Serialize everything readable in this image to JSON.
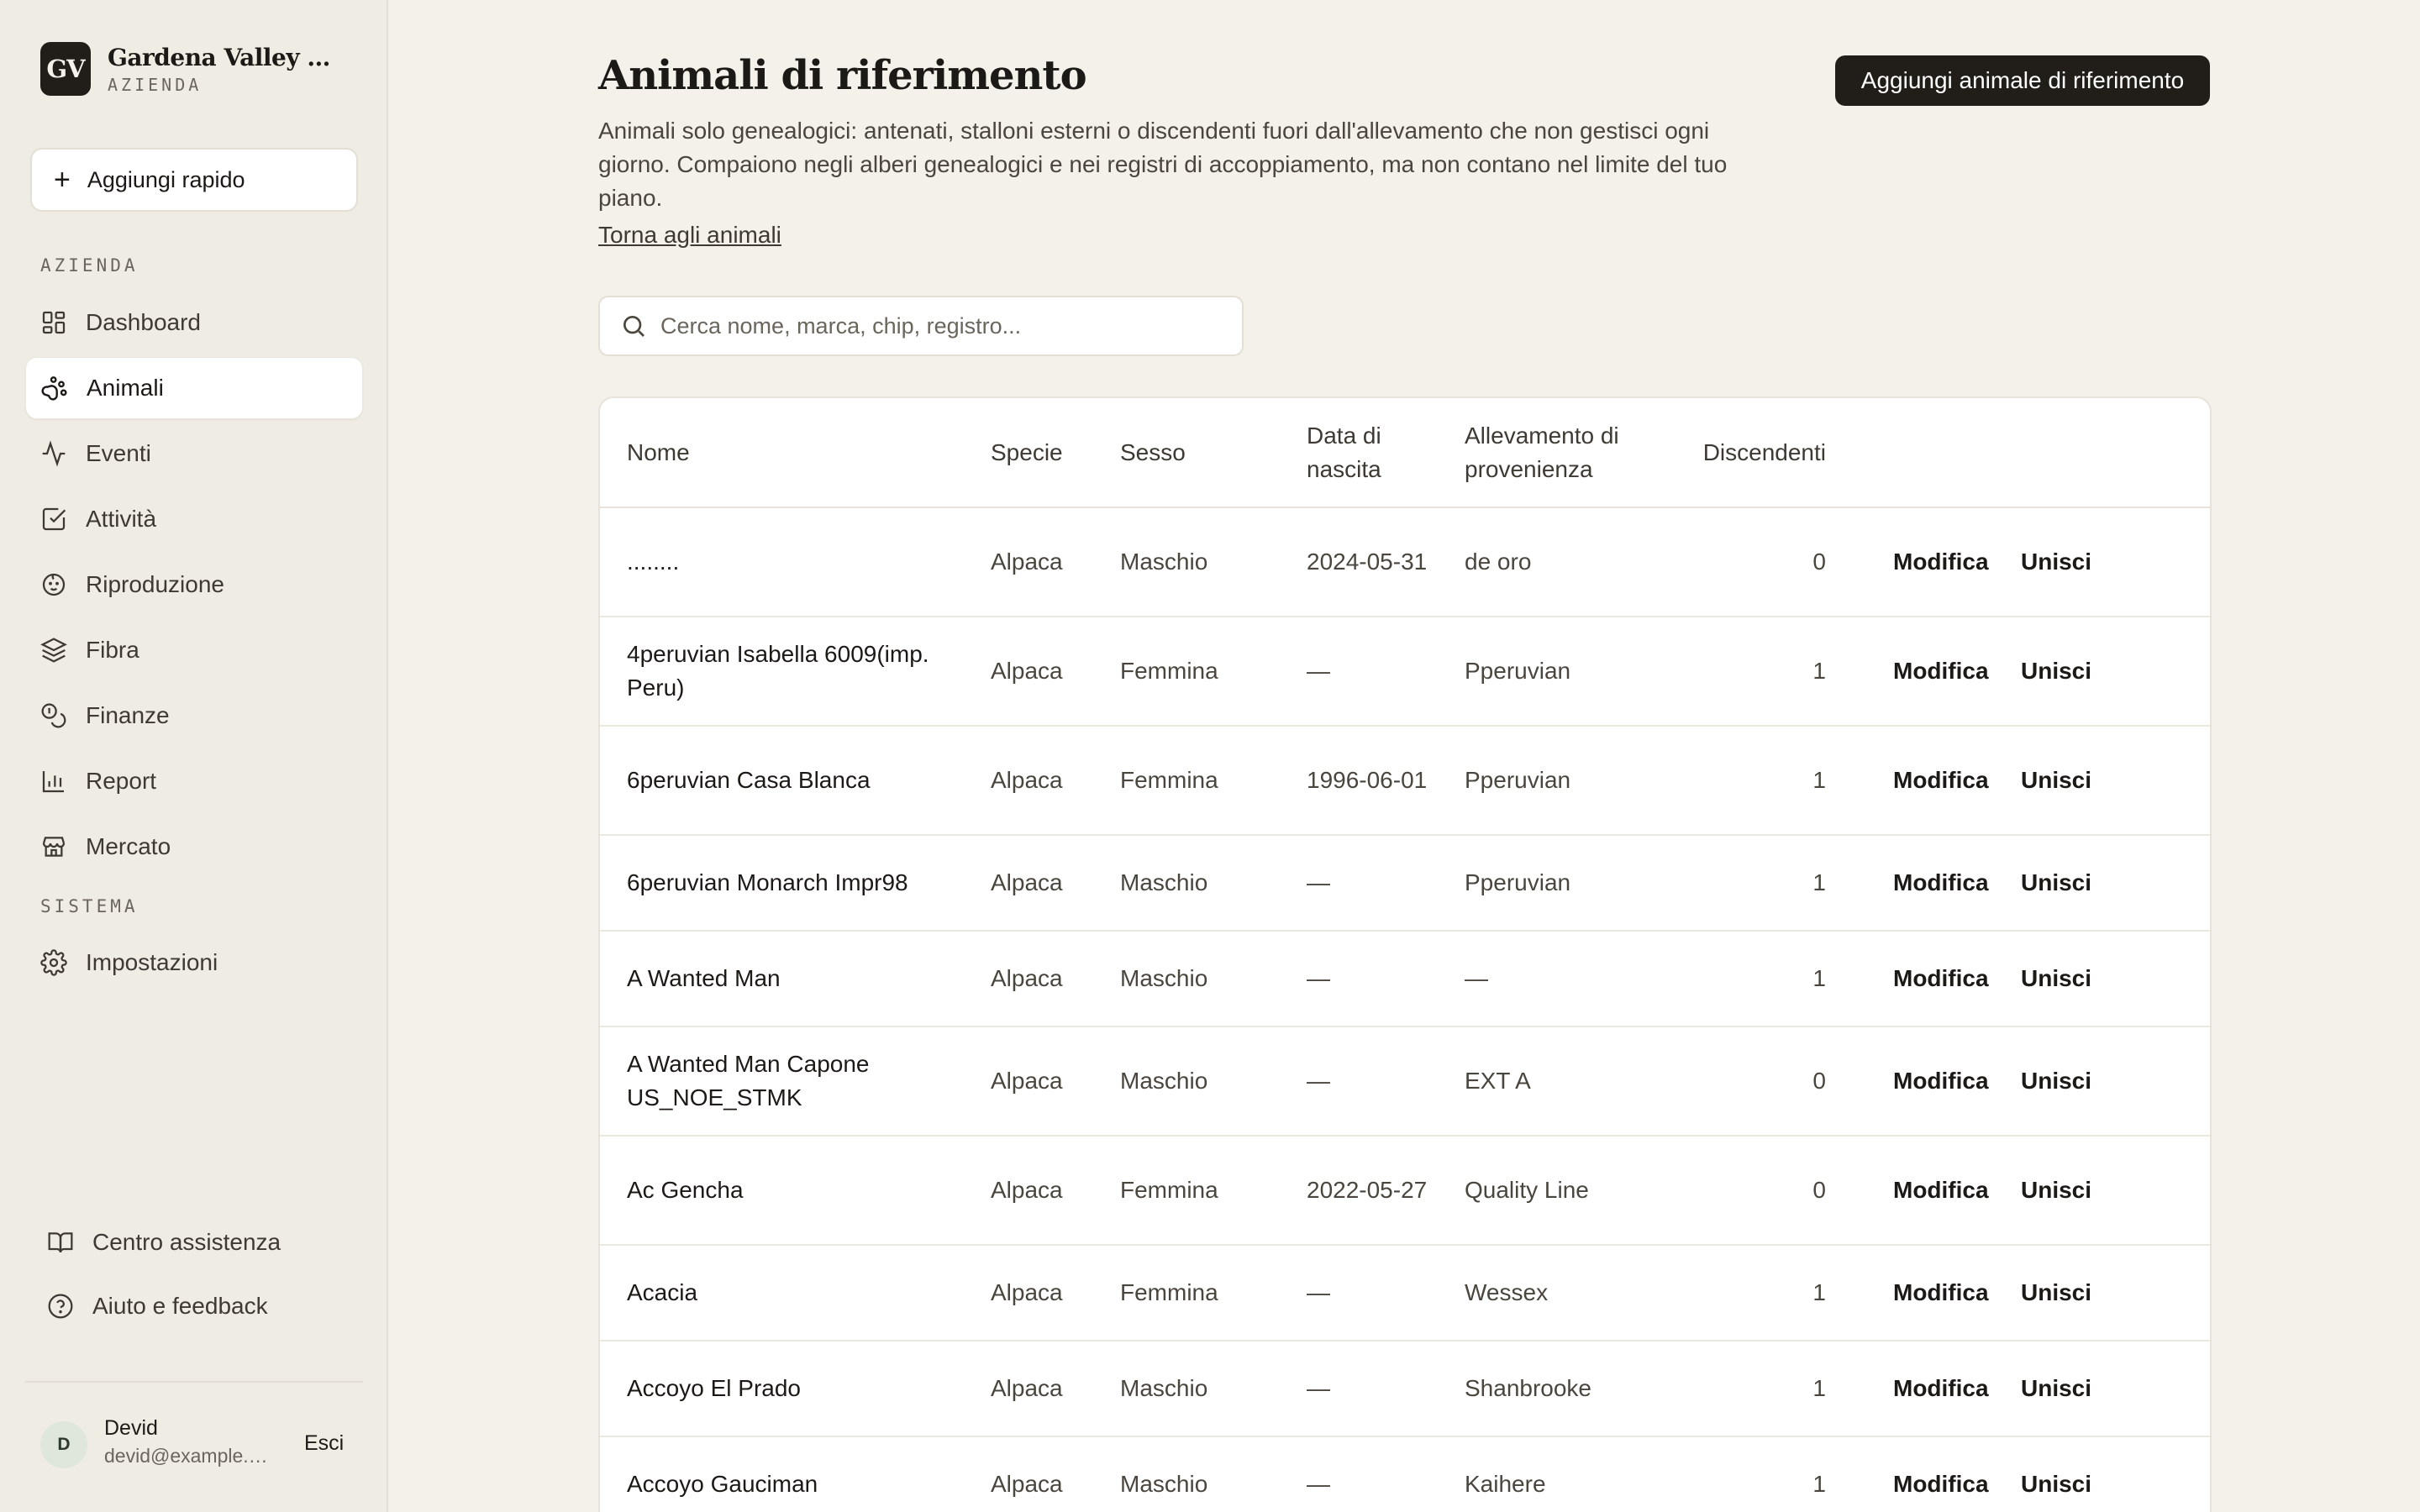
{
  "brand": {
    "logo_text": "GV",
    "name": "Gardena Valley Alpacas",
    "subtitle": "AZIENDA"
  },
  "quick_add": {
    "label": "Aggiungi rapido"
  },
  "sidebar": {
    "section_farm": "AZIENDA",
    "section_system": "SISTEMA",
    "items": [
      {
        "label": "Dashboard",
        "icon": "dashboard-icon"
      },
      {
        "label": "Animali",
        "icon": "paw-icon",
        "active": true
      },
      {
        "label": "Eventi",
        "icon": "activity-icon"
      },
      {
        "label": "Attività",
        "icon": "checkbox-icon"
      },
      {
        "label": "Riproduzione",
        "icon": "baby-icon"
      },
      {
        "label": "Fibra",
        "icon": "layers-icon"
      },
      {
        "label": "Finanze",
        "icon": "coins-icon"
      },
      {
        "label": "Report",
        "icon": "bar-chart-icon"
      },
      {
        "label": "Mercato",
        "icon": "store-icon"
      }
    ],
    "settings": {
      "label": "Impostazioni",
      "icon": "gear-icon"
    },
    "help_center": "Centro assistenza",
    "help_feedback": "Aiuto e feedback"
  },
  "user": {
    "initial": "D",
    "name": "Devid",
    "email": "devid@example.com",
    "logout": "Esci"
  },
  "page": {
    "title": "Animali di riferimento",
    "add_button": "Aggiungi animale di riferimento",
    "description": "Animali solo genealogici: antenati, stalloni esterni o discendenti fuori dall'allevamento che non gestisci ogni giorno. Compaiono negli alberi genealogici e nei registri di accoppiamento, ma non contano nel limite del tuo piano.",
    "back_link": "Torna agli animali",
    "search_placeholder": "Cerca nome, marca, chip, registro..."
  },
  "table": {
    "headers": {
      "name": "Nome",
      "species": "Specie",
      "sex": "Sesso",
      "birth": "Data di nascita",
      "origin": "Allevamento di provenienza",
      "descendants": "Discendenti"
    },
    "action_edit": "Modifica",
    "action_merge": "Unisci",
    "rows": [
      {
        "name": "........",
        "species": "Alpaca",
        "sex": "Maschio",
        "birth": "2024-05-31",
        "origin": "de oro",
        "descendants": "0"
      },
      {
        "name": "4peruvian Isabella 6009(imp. Peru)",
        "species": "Alpaca",
        "sex": "Femmina",
        "birth": "—",
        "origin": "Pperuvian",
        "descendants": "1"
      },
      {
        "name": "6peruvian Casa Blanca",
        "species": "Alpaca",
        "sex": "Femmina",
        "birth": "1996-06-01",
        "origin": "Pperuvian",
        "descendants": "1"
      },
      {
        "name": "6peruvian Monarch Impr98",
        "species": "Alpaca",
        "sex": "Maschio",
        "birth": "—",
        "origin": "Pperuvian",
        "descendants": "1"
      },
      {
        "name": "A Wanted Man",
        "species": "Alpaca",
        "sex": "Maschio",
        "birth": "—",
        "origin": "—",
        "descendants": "1"
      },
      {
        "name": "A Wanted Man Capone US_NOE_STMK",
        "species": "Alpaca",
        "sex": "Maschio",
        "birth": "—",
        "origin": "EXT A",
        "descendants": "0"
      },
      {
        "name": "Ac Gencha",
        "species": "Alpaca",
        "sex": "Femmina",
        "birth": "2022-05-27",
        "origin": "Quality Line",
        "descendants": "0"
      },
      {
        "name": "Acacia",
        "species": "Alpaca",
        "sex": "Femmina",
        "birth": "—",
        "origin": "Wessex",
        "descendants": "1"
      },
      {
        "name": "Accoyo El Prado",
        "species": "Alpaca",
        "sex": "Maschio",
        "birth": "—",
        "origin": "Shanbrooke",
        "descendants": "1"
      },
      {
        "name": "Accoyo Gauciman",
        "species": "Alpaca",
        "sex": "Maschio",
        "birth": "—",
        "origin": "Kaihere",
        "descendants": "1"
      }
    ]
  }
}
